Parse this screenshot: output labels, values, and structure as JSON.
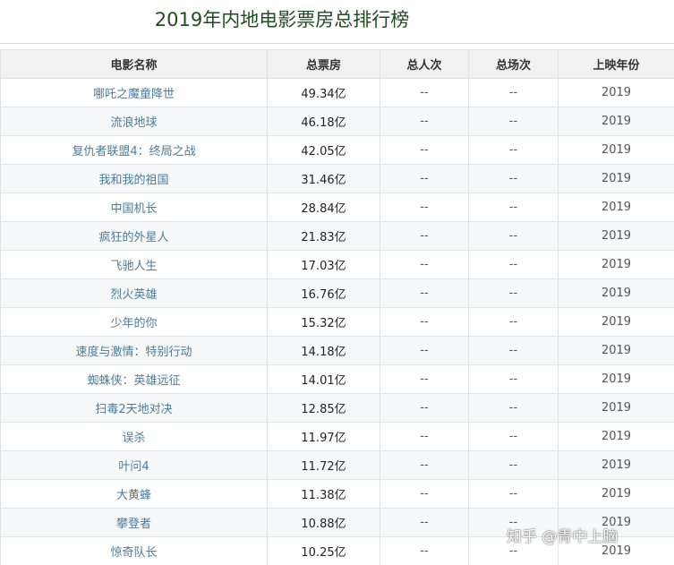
{
  "page": {
    "title": "2019年内地电影票房总排行榜",
    "watermark": "知乎 @青中上脑"
  },
  "table": {
    "headers": [
      "电影名称",
      "总票房",
      "总人次",
      "总场次",
      "上映年份"
    ],
    "rows": [
      {
        "name": "哪吒之魔童降世",
        "gross": "49.34亿",
        "admissions": "--",
        "screenings": "--",
        "year": "2019"
      },
      {
        "name": "流浪地球",
        "gross": "46.18亿",
        "admissions": "--",
        "screenings": "--",
        "year": "2019"
      },
      {
        "name": "复仇者联盟4：终局之战",
        "gross": "42.05亿",
        "admissions": "--",
        "screenings": "--",
        "year": "2019"
      },
      {
        "name": "我和我的祖国",
        "gross": "31.46亿",
        "admissions": "--",
        "screenings": "--",
        "year": "2019"
      },
      {
        "name": "中国机长",
        "gross": "28.84亿",
        "admissions": "--",
        "screenings": "--",
        "year": "2019"
      },
      {
        "name": "疯狂的外星人",
        "gross": "21.83亿",
        "admissions": "--",
        "screenings": "--",
        "year": "2019"
      },
      {
        "name": "飞驰人生",
        "gross": "17.03亿",
        "admissions": "--",
        "screenings": "--",
        "year": "2019"
      },
      {
        "name": "烈火英雄",
        "gross": "16.76亿",
        "admissions": "--",
        "screenings": "--",
        "year": "2019"
      },
      {
        "name": "少年的你",
        "gross": "15.32亿",
        "admissions": "--",
        "screenings": "--",
        "year": "2019"
      },
      {
        "name": "速度与激情：特别行动",
        "gross": "14.18亿",
        "admissions": "--",
        "screenings": "--",
        "year": "2019"
      },
      {
        "name": "蜘蛛侠：英雄远征",
        "gross": "14.01亿",
        "admissions": "--",
        "screenings": "--",
        "year": "2019"
      },
      {
        "name": "扫毒2天地对决",
        "gross": "12.85亿",
        "admissions": "--",
        "screenings": "--",
        "year": "2019"
      },
      {
        "name": "误杀",
        "gross": "11.97亿",
        "admissions": "--",
        "screenings": "--",
        "year": "2019"
      },
      {
        "name": "叶问4",
        "gross": "11.72亿",
        "admissions": "--",
        "screenings": "--",
        "year": "2019"
      },
      {
        "name": "大黄蜂",
        "gross": "11.38亿",
        "admissions": "--",
        "screenings": "--",
        "year": "2019"
      },
      {
        "name": "攀登者",
        "gross": "10.88亿",
        "admissions": "--",
        "screenings": "--",
        "year": "2019"
      },
      {
        "name": "惊奇队长",
        "gross": "10.25亿",
        "admissions": "--",
        "screenings": "--",
        "year": "2019"
      }
    ]
  },
  "colors": {
    "title": "#1e4d1e",
    "movie_name": "#4a7c9c",
    "header_bg": "#f1f1f1",
    "row_alt_bg": "#f6f8f9",
    "border": "#dfe3e6"
  }
}
